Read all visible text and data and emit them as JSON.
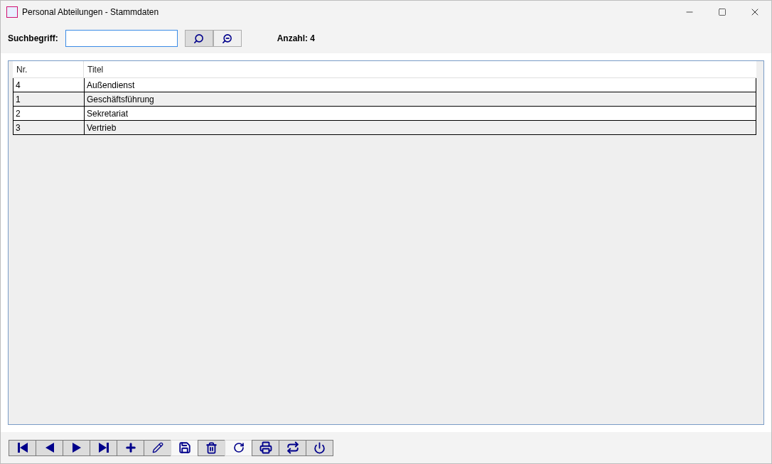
{
  "window": {
    "title": "Personal Abteilungen - Stammdaten"
  },
  "search": {
    "label": "Suchbegriff:",
    "buttons": [
      {
        "kind": "search",
        "selected": true
      },
      {
        "kind": "zoom-out",
        "selected": false
      }
    ],
    "count": "Anzahl: 4"
  },
  "table": {
    "columns": [
      "Nr.",
      "Titel"
    ],
    "rows": [
      [
        "4",
        "Außendienst"
      ],
      [
        "1",
        "Geschäftsführung"
      ],
      [
        "2",
        "Sekretariat"
      ],
      [
        "3",
        "Vertrieb"
      ]
    ]
  },
  "toolbar": [
    {
      "kind": "first",
      "disabled": false
    },
    {
      "kind": "prev",
      "disabled": false
    },
    {
      "kind": "next",
      "disabled": false
    },
    {
      "kind": "last",
      "disabled": false
    },
    {
      "kind": "add",
      "disabled": false
    },
    {
      "kind": "edit",
      "disabled": false
    },
    {
      "kind": "save",
      "disabled": true
    },
    {
      "kind": "delete",
      "disabled": false
    },
    {
      "kind": "undo",
      "disabled": true
    },
    {
      "kind": "print",
      "disabled": false
    },
    {
      "kind": "swap",
      "disabled": false
    },
    {
      "kind": "power",
      "disabled": false
    }
  ]
}
